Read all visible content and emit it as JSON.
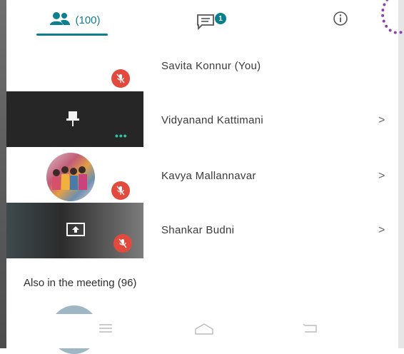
{
  "tabs": {
    "participants_count": "(100)",
    "chat_badge": "1"
  },
  "participants": [
    {
      "name": "Savita Konnur (You)"
    },
    {
      "name": "Vidyanand Kattimani"
    },
    {
      "name": "Kavya Mallannavar"
    },
    {
      "name": "Shankar Budni"
    }
  ],
  "also_in_meeting": {
    "title": "Also in the meeting (96)"
  },
  "icons": {
    "participants": "people-icon",
    "chat": "chat-icon",
    "info": "info-icon",
    "muted": "mic-off-icon",
    "pin": "pin-icon",
    "present": "screen-share-icon",
    "more": "more-dots-icon",
    "chevron": "chevron-right-icon"
  },
  "colors": {
    "accent": "#0e7f8f",
    "muted_red": "#e24a3d",
    "tile_dark": "#262626"
  }
}
